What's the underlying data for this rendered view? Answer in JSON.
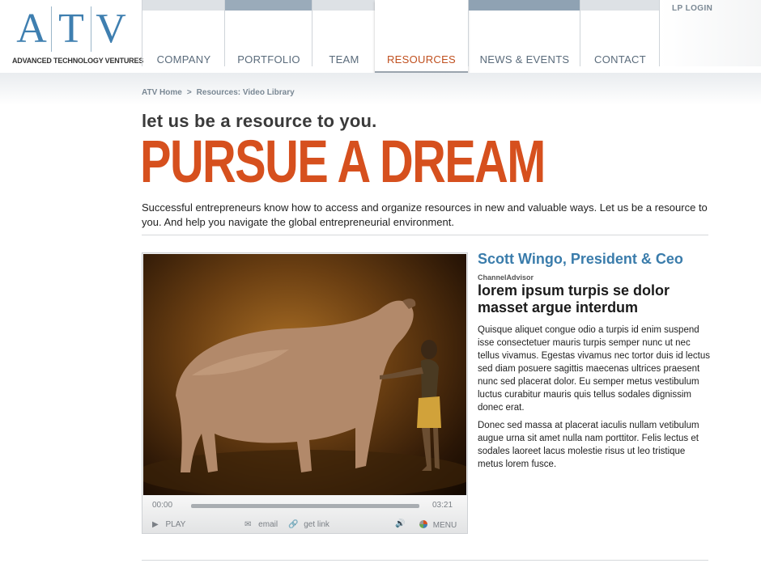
{
  "logo": {
    "letters": [
      "A",
      "T",
      "V"
    ],
    "tagline": "ADVANCED TECHNOLOGY VENTURES"
  },
  "nav": {
    "items": [
      {
        "label": "COMPANY",
        "bar_color": "#dde1e5"
      },
      {
        "label": "PORTFOLIO",
        "bar_color": "#9aabba"
      },
      {
        "label": "TEAM",
        "bar_color": "#dde1e5"
      },
      {
        "label": "RESOURCES",
        "bar_color": "#ffffff",
        "active": true
      },
      {
        "label": "NEWS & EVENTS",
        "bar_color": "#8fa2b3"
      },
      {
        "label": "CONTACT",
        "bar_color": "#dde1e5"
      }
    ],
    "login": "LP LOGIN"
  },
  "breadcrumb": {
    "home": "ATV Home",
    "separator": ">",
    "current": "Resources: Video Library"
  },
  "hero": {
    "tagline": "let us be a resource to you.",
    "headline": "PURSUE A DREAM",
    "intro": "Successful entrepreneurs know how to access and organize resources in new and valuable ways. Let us be a resource to you. And help you navigate the global entrepreneurial environment."
  },
  "player": {
    "current_time": "00:00",
    "duration": "03:21",
    "progress": 0,
    "play_label": "PLAY",
    "email_label": "email",
    "link_label": "get link",
    "menu_label": "MENU",
    "icons": [
      "play-icon",
      "envelope-icon",
      "link-icon",
      "speaker-icon",
      "menu-wheel-icon"
    ]
  },
  "article": {
    "person": "Scott Wingo, President & Ceo",
    "company": "ChannelAdvisor",
    "title": "lorem ipsum turpis se dolor masset argue interdum",
    "paragraphs": [
      "Quisque aliquet congue odio a turpis id enim suspend isse consectetuer mauris turpis semper nunc ut nec tellus vivamus. Egestas vivamus nec tortor duis id lectus sed diam posuere sagittis maecenas ultrices praesent nunc sed placerat dolor. Eu semper metus vestibulum luctus curabitur mauris quis tellus sodales dignissim donec erat.",
      "Donec sed massa at placerat iaculis nullam vetibulum augue urna sit amet nulla nam porttitor. Felis lectus et sodales laoreet lacus molestie risus ut leo tristique metus lorem fusce."
    ]
  },
  "colors": {
    "accent": "#d6501e",
    "brand_blue": "#3f7fb0",
    "link_blue": "#3a7cab"
  }
}
